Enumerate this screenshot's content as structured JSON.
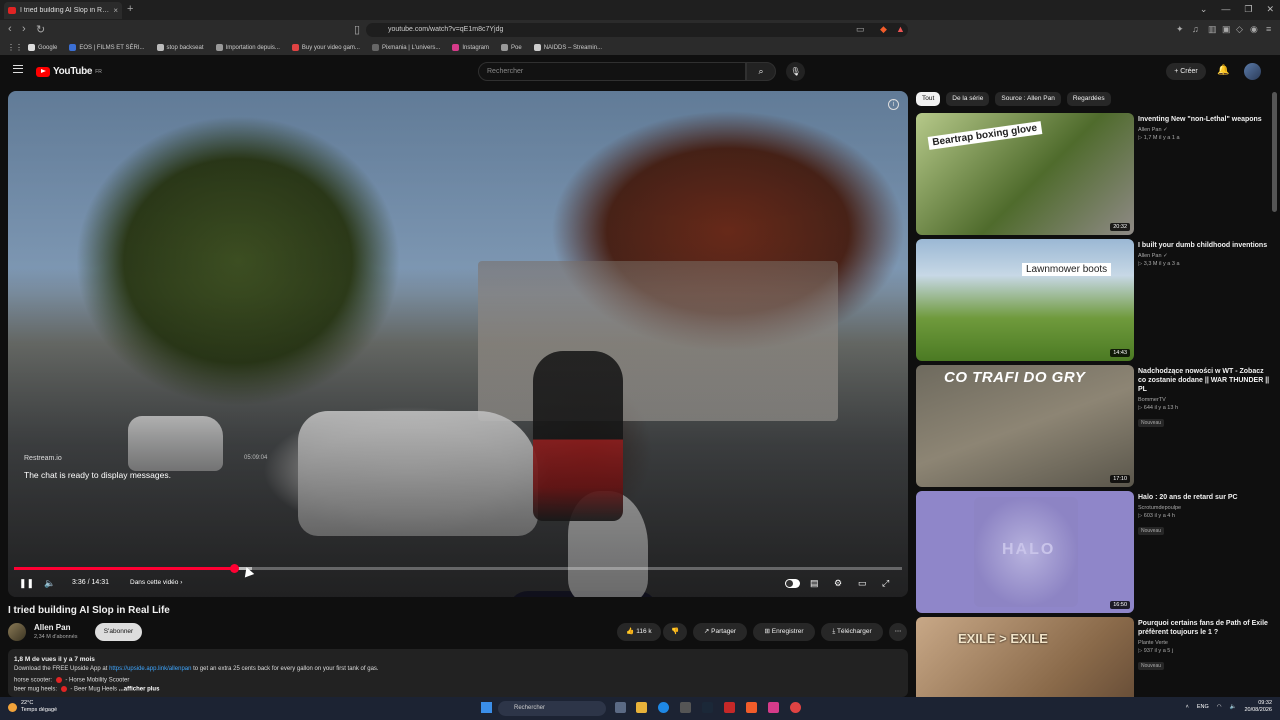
{
  "browser": {
    "tab_title": "I tried building AI Slop in Real Life",
    "tab_close": "×",
    "new_tab": "+",
    "url": "youtube.com/watch?v=qE1m8c7Yjdg",
    "window_controls": [
      "⌄",
      "—",
      "❐",
      "✕"
    ],
    "bookmarks": [
      "Google",
      "EOS | FILMS ET SÉRI...",
      "stop backseat",
      "Importation depuis...",
      "Buy your video gam...",
      "Pixmania | L'univers...",
      "Instagram",
      "Poe",
      "NAIDDS – Streamin..."
    ]
  },
  "youtube": {
    "logo": "YouTube",
    "logo_region": "FR",
    "search_placeholder": "Rechercher",
    "create_label": "+ Créer"
  },
  "player": {
    "overlay_source": "Restream.io",
    "overlay_time": "05:09:04",
    "chat_message": "The chat is ready to display messages.",
    "time": "3:36 / 14:31",
    "chapter": "Dans cette vidéo",
    "progress": 0.248
  },
  "video": {
    "title": "I tried building AI Slop in Real Life",
    "channel": "Allen Pan",
    "subscribers": "2,34 M d'abonnés",
    "subscribe_label": "S'abonner",
    "likes": "116 k",
    "share_label": "Partager",
    "save_label": "Enregistrer",
    "download_label": "Télécharger",
    "views_date": "1,8 M de vues  il y a 7 mois",
    "desc_line_prefix": "Download the FREE Upside App at ",
    "desc_link": "https://upside.app.link/allenpan",
    "desc_line_suffix": " to get an extra 25 cents back for every gallon on your first tank of gas.",
    "desc_horse_label": "horse scooter:",
    "desc_horse_value": " - Horse Mobility Scooter",
    "desc_mug_label": "beer mug heels:",
    "desc_mug_value": " - Beer Mug Heels",
    "show_more": "...afficher plus"
  },
  "sidebar": {
    "chips": [
      "Tout",
      "De la série",
      "Source : Allen Pan",
      "Regardées"
    ],
    "recommendations": [
      {
        "title": "Inventing New \"non-Lethal\" weapons",
        "channel": "Allen Pan ✓",
        "meta": "▷ 1,7 M  il y a 1 a",
        "duration": "20:32",
        "thumb_text": "Beartrap boxing glove",
        "badge": ""
      },
      {
        "title": "I built your dumb childhood inventions",
        "channel": "Allen Pan ✓",
        "meta": "▷ 3,3 M  il y a 3 a",
        "duration": "14:43",
        "thumb_text": "Lawnmower boots",
        "badge": ""
      },
      {
        "title": "Nadchodzące nowości w WT - Zobacz co zostanie dodane || WAR THUNDER || PL",
        "channel": "BommerTV",
        "meta": "▷ 644  il y a 13 h",
        "duration": "17:10",
        "thumb_text": "CO TRAFI DO GRY",
        "badge": "Nouveau"
      },
      {
        "title": "Halo : 20 ans de retard sur PC",
        "channel": "Scrotumdepoulpe",
        "meta": "▷ 603  il y a 4 h",
        "duration": "16:50",
        "thumb_text": "HALO",
        "badge": "Nouveau"
      },
      {
        "title": "Pourquoi certains fans de Path of Exile préfèrent toujours le 1 ?",
        "channel": "Plante Verte",
        "meta": "▷ 937  il y a 5 j",
        "duration": "",
        "thumb_text": "EXILE > EXILE",
        "badge": "Nouveau"
      }
    ]
  },
  "taskbar": {
    "weather_temp": "22°C",
    "weather_desc": "Temps dégagé",
    "search_placeholder": "Rechercher",
    "lang": "ENG",
    "time": "09:32",
    "date": "20/08/2026"
  },
  "colors": {
    "accent": "#ff0033",
    "link": "#3ea6ff"
  }
}
